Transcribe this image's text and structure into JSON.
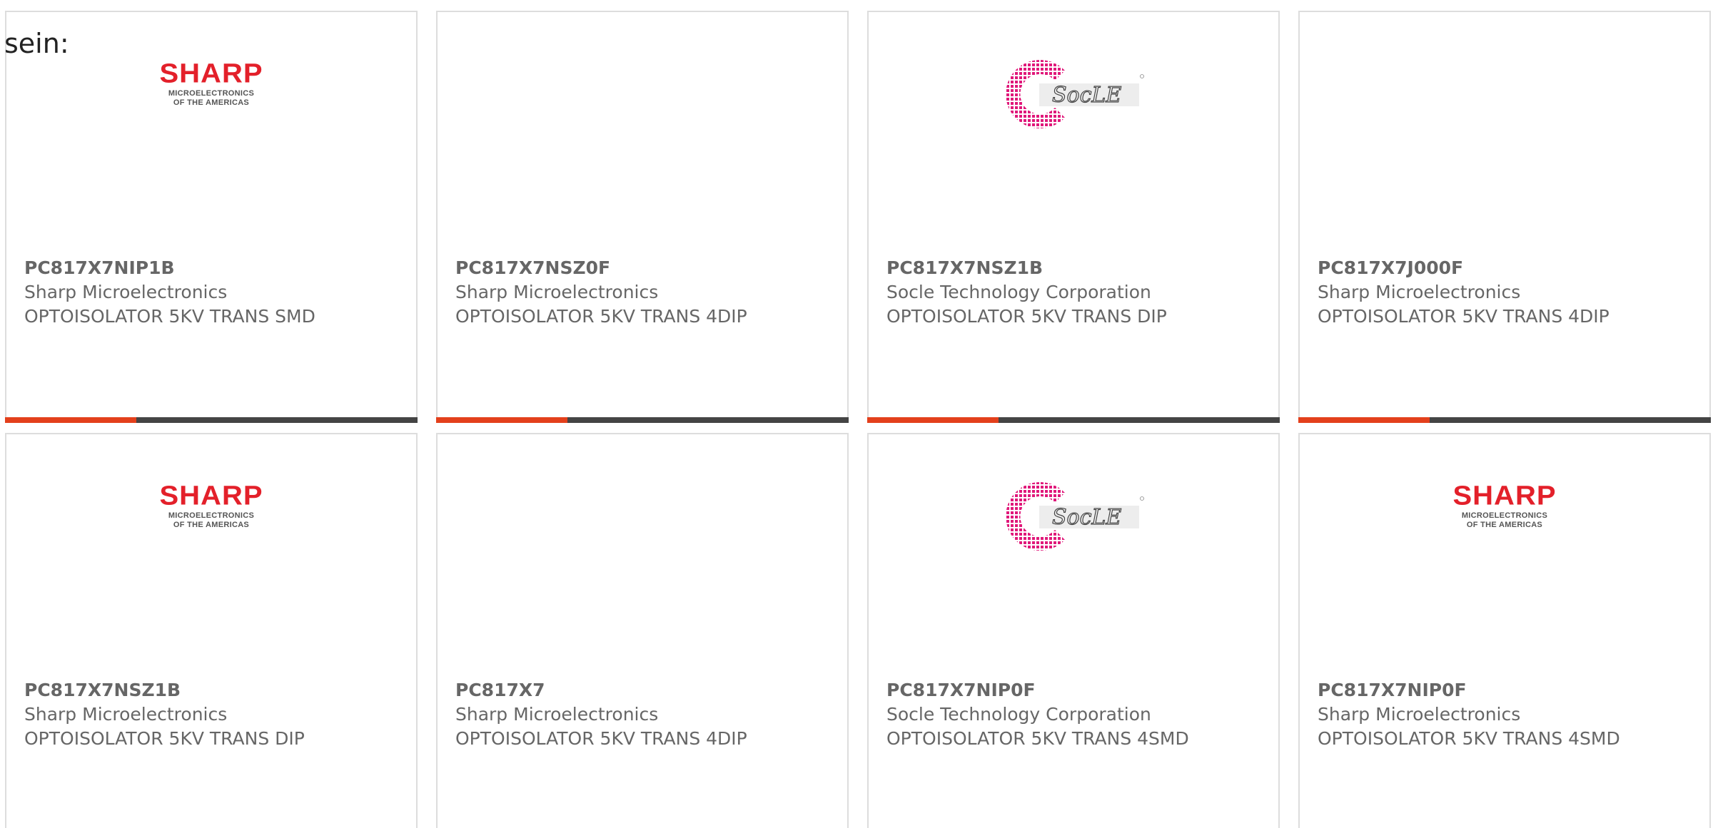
{
  "lead_text": "sein:",
  "colors": {
    "accent": "#e3401c",
    "bar_dark": "#444444",
    "text": "#666666",
    "border": "#dddddd",
    "sharp_red": "#e3202a",
    "socle_pink": "#e0187a"
  },
  "products": [
    {
      "part": "PC817X7NIP1B",
      "manufacturer": "Sharp Microelectronics",
      "description": "OPTOISOLATOR 5KV TRANS SMD",
      "image": "sharp-logo",
      "logo_word": "SHARP",
      "logo_line1": "MICROELECTRONICS",
      "logo_line2": "OF THE AMERICAS"
    },
    {
      "part": "PC817X7NSZ0F",
      "manufacturer": "Sharp Microelectronics",
      "description": "OPTOISOLATOR 5KV TRANS 4DIP",
      "image": "dip4-chip"
    },
    {
      "part": "PC817X7NSZ1B",
      "manufacturer": "Socle Technology Corporation",
      "description": "OPTOISOLATOR 5KV TRANS DIP",
      "image": "socle-logo",
      "logo_word": "SocLE"
    },
    {
      "part": "PC817X7J000F",
      "manufacturer": "Sharp Microelectronics",
      "description": "OPTOISOLATOR 5KV TRANS 4DIP",
      "image": "dip4-chip"
    },
    {
      "part": "PC817X7NSZ1B",
      "manufacturer": "Sharp Microelectronics",
      "description": "OPTOISOLATOR 5KV TRANS DIP",
      "image": "sharp-logo",
      "logo_word": "SHARP",
      "logo_line1": "MICROELECTRONICS",
      "logo_line2": "OF THE AMERICAS"
    },
    {
      "part": "PC817X7",
      "manufacturer": "Sharp Microelectronics",
      "description": "OPTOISOLATOR 5KV TRANS 4DIP",
      "image": "dip4-chip"
    },
    {
      "part": "PC817X7NIP0F",
      "manufacturer": "Socle Technology Corporation",
      "description": "OPTOISOLATOR 5KV TRANS 4SMD",
      "image": "socle-logo",
      "logo_word": "SocLE"
    },
    {
      "part": "PC817X7NIP0F",
      "manufacturer": "Sharp Microelectronics",
      "description": "OPTOISOLATOR 5KV TRANS 4SMD",
      "image": "sharp-logo",
      "logo_word": "SHARP",
      "logo_line1": "MICROELECTRONICS",
      "logo_line2": "OF THE AMERICAS"
    }
  ]
}
